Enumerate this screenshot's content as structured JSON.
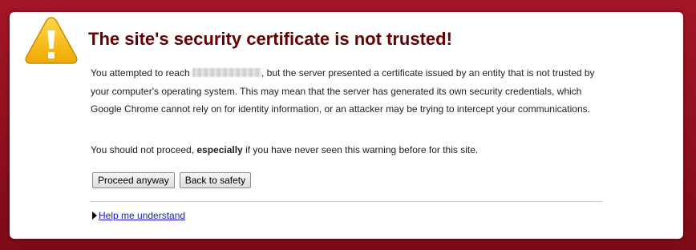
{
  "page": {
    "title": "The site's security certificate is not trusted!",
    "paragraph1_before": "You attempted to reach",
    "paragraph1_after": ", but the server presented a certificate issued by an entity that is not trusted by your computer's operating system. This may mean that the server has generated its own security credentials, which Google Chrome cannot rely on for identity information, or an attacker may be trying to intercept your communications.",
    "paragraph2_before": "You should not proceed,",
    "paragraph2_bold": "especially",
    "paragraph2_after": "if you have never seen this warning before for this site."
  },
  "buttons": {
    "proceed_label": "Proceed anyway",
    "back_label": "Back to safety"
  },
  "help": {
    "link_label": "Help me understand"
  },
  "icons": {
    "warning": "warning-triangle-icon",
    "expand": "triangle-right-icon"
  },
  "colors": {
    "background": "#8d0f1e",
    "title": "#660000",
    "icon_fill": "#f5b400",
    "link": "#1a1ad0"
  }
}
